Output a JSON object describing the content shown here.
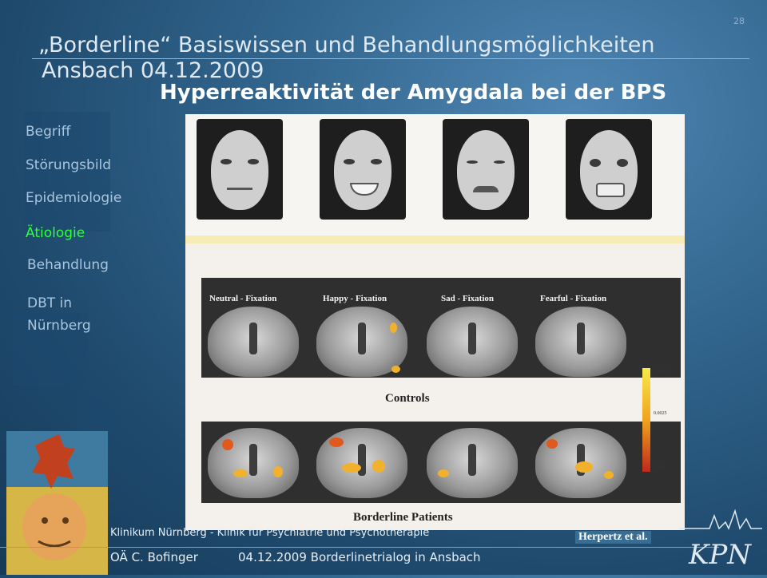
{
  "slide": {
    "number": "28"
  },
  "header": {
    "title": "„Borderline“  Basiswissen und Behandlungsmöglichkeiten",
    "subtitle": "Ansbach 04.12.2009"
  },
  "slide_title": "Hyperreaktivität der Amygdala bei der BPS",
  "nav": {
    "items": [
      {
        "label": "Begriff",
        "active": false
      },
      {
        "label": "Störungsbild",
        "active": false
      },
      {
        "label": "Epidemiologie",
        "active": false
      },
      {
        "label": "Ätiologie",
        "active": true
      },
      {
        "label": "Behandlung",
        "active": false
      },
      {
        "label": "DBT in",
        "active": false
      },
      {
        "label": "Nürnberg",
        "active": false
      }
    ]
  },
  "figure": {
    "panel_labels": [
      "Neutral - Fixation",
      "Happy - Fixation",
      "Sad - Fixation",
      "Fearful - Fixation"
    ],
    "controls_caption": "Controls",
    "patients_caption": "Borderline Patients",
    "scale_title": "p-values",
    "scale_ticks": [
      "0.0005",
      "0.0025",
      "0.005"
    ],
    "credit": "Herpertz et al."
  },
  "footer": {
    "institution": "Klinikum Nürnberg - Klinik für Psychiatrie und Psychotherapie",
    "author": "OÄ C. Bofinger",
    "event": "04.12.2009 Borderlinetrialog in Ansbach"
  },
  "logo": {
    "text": "KPN"
  },
  "colors": {
    "background": "#2c5d86",
    "accent_active": "#2fff3a",
    "rule": "#c9b04a"
  }
}
